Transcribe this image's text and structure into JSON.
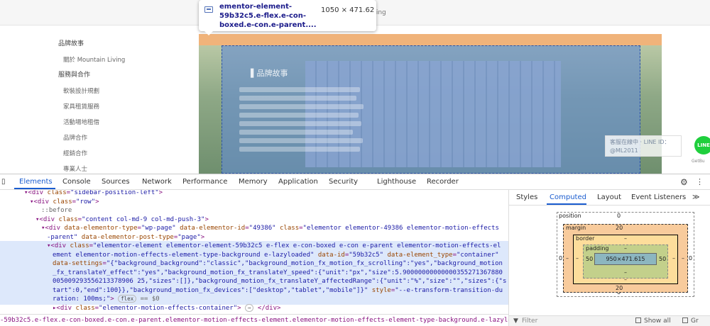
{
  "page": {
    "topbar_text": "iving",
    "sidebar": [
      {
        "label": "品牌故事",
        "head": true
      },
      {
        "label": "關於 Mountain Living",
        "head": false
      },
      {
        "label": "服務與合作",
        "head": true
      },
      {
        "label": "軟裝設計規劃",
        "head": false
      },
      {
        "label": "家具租賃服務",
        "head": false
      },
      {
        "label": "活動場地租借",
        "head": false
      },
      {
        "label": "品牌合作",
        "head": false
      },
      {
        "label": "經銷合作",
        "head": false
      },
      {
        "label": "專業人士",
        "head": false
      }
    ],
    "overlay_title": "▌品牌故事",
    "line_widget": {
      "line1": "客服在線中 · LINE ID：",
      "line2": "@ML2011"
    },
    "line_icon": "LINE",
    "getbutton": "GetBu"
  },
  "tooltip": {
    "element_name": "ementor-element-59b32c5.e-flex.e-con-boxed.e-con.e-parent....",
    "size": "1050 × 471.62"
  },
  "devtools": {
    "tabs": [
      "Elements",
      "Console",
      "Sources",
      "Network",
      "Performance",
      "Memory",
      "Application",
      "Security",
      "Lighthouse",
      "Recorder"
    ],
    "active_tab": "Elements",
    "dom_lines": [
      {
        "indent": 4,
        "html": "▾<span class='tag'>&lt;div</span> <span class='attr'>class</span>=<span class='val'>\"sidebar-position-left\"</span><span class='tag'>&gt;</span>"
      },
      {
        "indent": 5,
        "html": "▾<span class='tag'>&lt;div</span> <span class='attr'>class</span>=<span class='val'>\"row\"</span><span class='tag'>&gt;</span>"
      },
      {
        "indent": 7,
        "html": "<span class='cm'>::before</span>"
      },
      {
        "indent": 6,
        "html": "▾<span class='tag'>&lt;div</span> <span class='attr'>class</span>=<span class='val'>\"content col-md-9 col-md-push-3\"</span><span class='tag'>&gt;</span>"
      },
      {
        "indent": 7,
        "html": "▾<span class='tag'>&lt;div</span> <span class='attr'>data-elementor-type</span>=<span class='val'>\"wp-page\"</span> <span class='attr'>data-elementor-id</span>=<span class='val'>\"49386\"</span> <span class='attr'>class</span>=<span class='val'>\"elementor elementor-49386 elementor-motion-effects</span>"
      },
      {
        "indent": 8,
        "html": "<span class='val'>-parent\"</span> <span class='attr'>data-elementor-post-type</span>=<span class='val'>\"page\"</span><span class='tag'>&gt;</span>"
      },
      {
        "indent": 8,
        "html": "▾<span class='tag'>&lt;div</span> <span class='attr'>class</span>=<span class='val'>\"elementor-element elementor-element-59b32c5 e-flex e-con-boxed e-con e-parent elementor-motion-effects-el</span>"
      },
      {
        "indent": 9,
        "html": "<span class='val'>ement elementor-motion-effects-element-type-background e-lazyloaded\"</span> <span class='attr'>data-id</span>=<span class='val'>\"59b32c5\"</span> <span class='attr'>data-element_type</span>=<span class='val'>\"container\"</span>"
      },
      {
        "indent": 9,
        "html": "<span class='attr'>data-settings</span>=<span class='val'>\"{\"background_background\":\"classic\",\"background_motion_fx_motion_fx_scrolling\":\"yes\",\"background_motion</span>"
      },
      {
        "indent": 9,
        "html": "<span class='val'>_fx_translateY_effect\":\"yes\",\"background_motion_fx_translateY_speed\":{\"unit\":\"px\",\"size\":5.90000000000000355271367880</span>"
      },
      {
        "indent": 9,
        "html": "<span class='val'>005009293556213378906 25,\"sizes\":[]},\"background_motion_fx_translateY_affectedRange\":{\"unit\":\"%\",\"size\":\"\",\"sizes\":{\"s</span>"
      },
      {
        "indent": 9,
        "html": "<span class='val'>tart\":0,\"end\":100}},\"background_motion_fx_devices\":[\"desktop\",\"tablet\",\"mobile\"]}\"</span> <span class='attr'>style</span>=<span class='val'>\"--e-transform-transition-du</span>"
      },
      {
        "indent": 9,
        "html": "<span class='val'>ration: 100ms;\"</span><span class='tag'>&gt;</span> <span class='pill'>flex</span> <span class='cm'>== $0</span>"
      },
      {
        "indent": 9,
        "html": "▸<span class='tag'>&lt;div</span> <span class='attr'>class</span>=<span class='val'>\"elementor-motion-effects-container\"</span><span class='tag'>&gt;</span> <span class='pill'>⋯</span> <span class='tag'>&lt;/div&gt;</span>"
      }
    ],
    "breadcrumb": "-59b32c5.e-flex.e-con-boxed.e-con.e-parent.elementor-motion-effects-element.elementor-motion-effects-element-type-background.e-lazyloaded",
    "side_tabs": [
      "Styles",
      "Computed",
      "Layout",
      "Event Listeners"
    ],
    "side_active": "Computed",
    "box_model": {
      "position_label": "position",
      "position_top": "0",
      "position_left": "0",
      "position_right": "0",
      "position_bottom": "0",
      "margin_label": "margin",
      "margin_top": "20",
      "margin_bottom": "20",
      "margin_left": "–",
      "margin_right": "–",
      "border_label": "border",
      "border_top": "–",
      "border_bottom": "–",
      "border_left": "–",
      "border_right": "–",
      "padding_label": "padding",
      "padding_top": "–",
      "padding_bottom": "–",
      "padding_left": "50",
      "padding_right": "50",
      "content": "950×471.615"
    },
    "filter_placeholder": "Filter",
    "show_all": "Show all",
    "group": "Gr"
  }
}
